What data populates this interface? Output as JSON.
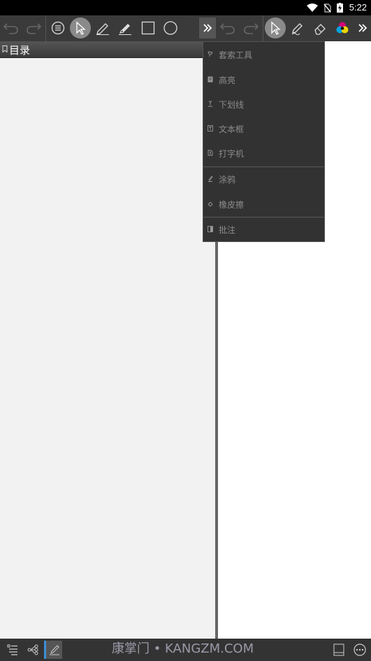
{
  "status": {
    "time": "5:22"
  },
  "panel": {
    "title": "目录"
  },
  "menu": {
    "items": [
      {
        "label": "套索工具",
        "icon": "lasso-icon"
      },
      {
        "label": "高亮",
        "icon": "highlight-icon"
      },
      {
        "label": "下划线",
        "icon": "underline-icon"
      },
      {
        "label": "文本框",
        "icon": "textbox-icon"
      },
      {
        "label": "打字机",
        "icon": "typewriter-icon"
      },
      {
        "label": "涂鸦",
        "icon": "scribble-icon"
      },
      {
        "label": "橡皮擦",
        "icon": "eraser-icon"
      },
      {
        "label": "批注",
        "icon": "note-icon"
      }
    ]
  },
  "watermark": "康掌门 • KANGZM.COM",
  "colors": {
    "toolbar": "#3a3a3a",
    "menu": "#323232",
    "accent": "#3a8fd9",
    "pane_left": "#f2f2f2"
  }
}
